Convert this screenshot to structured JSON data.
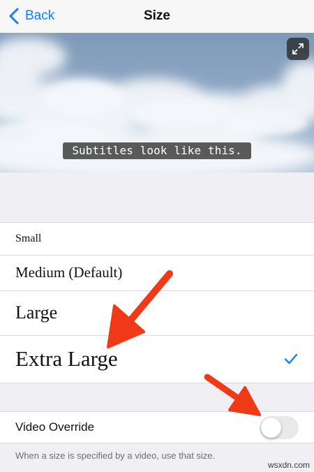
{
  "navbar": {
    "back_label": "Back",
    "title": "Size"
  },
  "preview": {
    "subtitle_text": "Subtitles look like this."
  },
  "sizes": [
    {
      "label": "Small",
      "selected": false
    },
    {
      "label": "Medium (Default)",
      "selected": false
    },
    {
      "label": "Large",
      "selected": false
    },
    {
      "label": "Extra Large",
      "selected": true
    }
  ],
  "override": {
    "label": "Video Override",
    "enabled": false
  },
  "footer_text": "When a size is specified by a video, use that size.",
  "watermark": "wsxdn.com",
  "colors": {
    "accent": "#147efb",
    "annotation_arrow": "#f03a17",
    "toggle_off": "#e9e9eb"
  },
  "icons": {
    "back": "chevron-left-icon",
    "expand": "expand-icon",
    "check": "checkmark-icon"
  }
}
